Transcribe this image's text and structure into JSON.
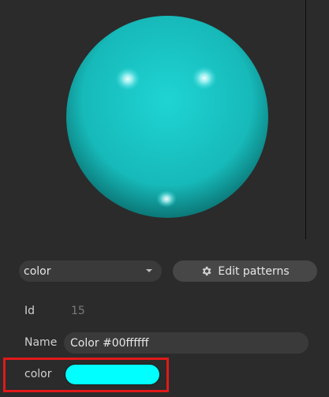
{
  "preview": {
    "sphere_color": "#00ffff",
    "background_color": "#2b2b2b"
  },
  "pattern_select": {
    "value": "color"
  },
  "edit_patterns_button": {
    "label": "Edit patterns",
    "icon": "gear-icon"
  },
  "properties": {
    "id_label": "Id",
    "id_value": "15",
    "name_label": "Name",
    "name_value": "Color #00ffffff",
    "color_label": "color",
    "color_value": "#00ffff"
  }
}
